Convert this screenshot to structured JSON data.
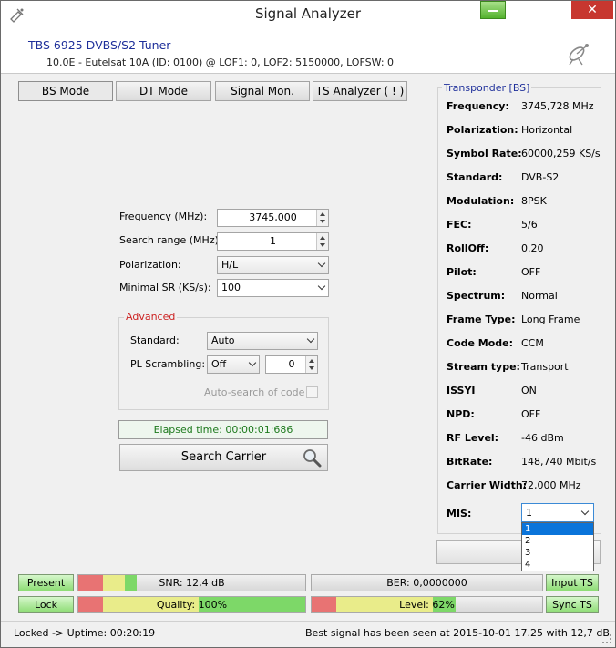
{
  "window": {
    "title": "Signal Analyzer",
    "close_glyph": "✕"
  },
  "header": {
    "tuner_name": "TBS 6925 DVBS/S2 Tuner",
    "tuner_info": "10.0E - Eutelsat 10A (ID: 0100) @ LOF1: 0, LOF2: 5150000, LOFSW: 0"
  },
  "tabs": [
    {
      "label": "BS Mode",
      "active": true
    },
    {
      "label": "DT Mode"
    },
    {
      "label": "Signal Mon."
    },
    {
      "label": "TS Analyzer ( ! )"
    }
  ],
  "form": {
    "frequency_label": "Frequency (MHz):",
    "frequency_value": "3745,000",
    "search_range_label": "Search range (MHz):",
    "search_range_value": "1",
    "polarization_label": "Polarization:",
    "polarization_value": "H/L",
    "min_sr_label": "Minimal SR (KS/s):",
    "min_sr_value": "100"
  },
  "advanced": {
    "title": "Advanced",
    "standard_label": "Standard:",
    "standard_value": "Auto",
    "pl_label": "PL Scrambling:",
    "pl_value": "Off",
    "pl_number": "0",
    "autosearch_label": "Auto-search of code"
  },
  "elapsed": "Elapsed time: 00:00:01:686",
  "search_button": "Search Carrier",
  "transponder": {
    "title": "Transponder [BS]",
    "rows": [
      {
        "label": "Frequency:",
        "value": "3745,728 MHz"
      },
      {
        "label": "Polarization:",
        "value": "Horizontal"
      },
      {
        "label": "Symbol Rate:",
        "value": "60000,259 KS/s"
      },
      {
        "label": "Standard:",
        "value": "DVB-S2"
      },
      {
        "label": "Modulation:",
        "value": "8PSK"
      },
      {
        "label": "FEC:",
        "value": "5/6"
      },
      {
        "label": "RollOff:",
        "value": "0.20"
      },
      {
        "label": "Pilot:",
        "value": "OFF"
      },
      {
        "label": "Spectrum:",
        "value": "Normal"
      },
      {
        "label": "Frame Type:",
        "value": "Long Frame"
      },
      {
        "label": "Code Mode:",
        "value": "CCM"
      },
      {
        "label": "Stream type:",
        "value": "Transport"
      },
      {
        "label": "ISSYI",
        "value": "ON"
      },
      {
        "label": "NPD:",
        "value": "OFF"
      },
      {
        "label": "RF Level:",
        "value": "-46 dBm"
      },
      {
        "label": "BitRate:",
        "value": "148,740 Mbit/s"
      },
      {
        "label": "Carrier Width:",
        "value": "72,000 MHz"
      }
    ],
    "mis_label": "MIS:",
    "mis_value": "1",
    "mis_options": [
      "1",
      "2",
      "3",
      "4"
    ]
  },
  "status": {
    "present": "Present",
    "lock": "Lock",
    "snr_text": "SNR: 12,4 dB",
    "snr_fraction": 0.26,
    "quality_text": "Quality: 100%",
    "quality_fraction": 1.0,
    "ber_text": "BER: 0,0000000",
    "level_text": "Level: 62%",
    "level_fraction": 0.62,
    "input_ts": "Input TS",
    "sync_ts": "Sync TS"
  },
  "statusbar": {
    "left": "Locked -> Uptime: 00:20:19",
    "right": "Best signal has been seen at 2015-10-01 17.25 with 12,7 dB"
  },
  "colors": {
    "tuner_name": "#1e2f9a",
    "advanced_title": "#cc2222",
    "green": "#7dd868",
    "yellow": "#e9ec8a",
    "red": "#e87373"
  }
}
